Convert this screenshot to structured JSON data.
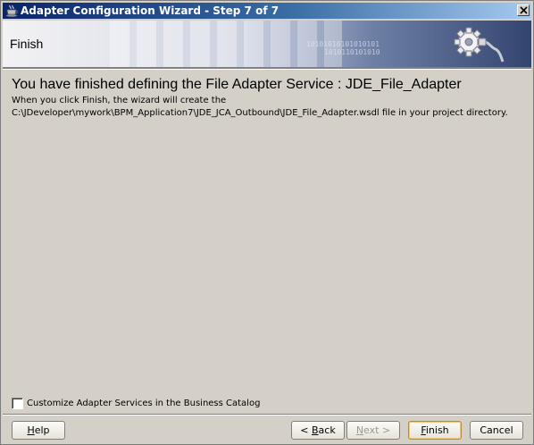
{
  "window": {
    "title": "Adapter Configuration Wizard - Step 7 of 7"
  },
  "banner": {
    "title": "Finish",
    "binary_line_1": "10101010101010101",
    "binary_line_2": "1010110101010"
  },
  "content": {
    "headline": "You have finished defining the File Adapter Service : JDE_File_Adapter",
    "info_line_1": "When you click Finish, the wizard will create the",
    "info_line_2": "C:\\JDeveloper\\mywork\\BPM_Application7\\JDE_JCA_Outbound\\JDE_File_Adapter.wsdl file in your project directory."
  },
  "catalog_checkbox": {
    "label": "Customize Adapter Services in the Business Catalog",
    "checked": false
  },
  "buttons": {
    "help_mnemonic": "H",
    "help_rest": "elp",
    "back_prefix": "< ",
    "back_mnemonic": "B",
    "back_rest": "ack",
    "next_mnemonic": "N",
    "next_rest": "ext >",
    "finish_mnemonic": "F",
    "finish_rest": "inish",
    "cancel_label": "Cancel"
  },
  "icons": {
    "app": "coffee-cup-icon",
    "close": "close-icon",
    "banner": "gear-plug-icon"
  },
  "colors": {
    "titlebar_start": "#0a246a",
    "titlebar_end": "#a6caf0",
    "dialog_bg": "#d4d0c8"
  }
}
